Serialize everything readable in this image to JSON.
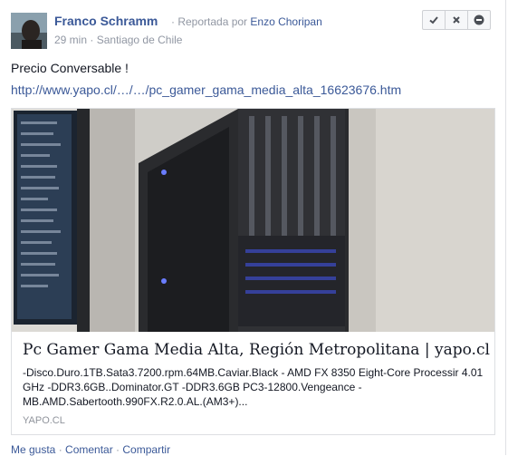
{
  "post": {
    "author": "Franco Schramm",
    "reported_prefix": "· Reportada por ",
    "reported_by": "Enzo Choripan",
    "time": "29 min",
    "location": "Santiago de Chile",
    "message": "Precio Conversable !",
    "link_text": "http://www.yapo.cl/…/…/pc_gamer_gama_media_alta_16623676.htm",
    "actions": [
      {
        "name": "approve",
        "icon": "check-icon"
      },
      {
        "name": "remove",
        "icon": "close-icon"
      },
      {
        "name": "block",
        "icon": "minus-circle-icon"
      }
    ]
  },
  "card": {
    "title": "Pc Gamer Gama Media Alta, Región Metropolitana | yapo.cl",
    "description": "-Disco.Duro.1TB.Sata3.7200.rpm.64MB.Caviar.Black - AMD FX 8350 Eight-Core Processir 4.01 GHz -DDR3.6GB..Dominator.GT -DDR3.6GB PC3-12800.Vengeance - MB.AMD.Sabertooth.990FX.R2.0.AL.(AM3+)...",
    "source": "YAPO.CL"
  },
  "footer": {
    "like": "Me gusta",
    "comment": "Comentar",
    "share": "Compartir",
    "separator": " · "
  },
  "colors": {
    "link": "#3b5998",
    "meta": "#9197a3",
    "text": "#141823"
  }
}
